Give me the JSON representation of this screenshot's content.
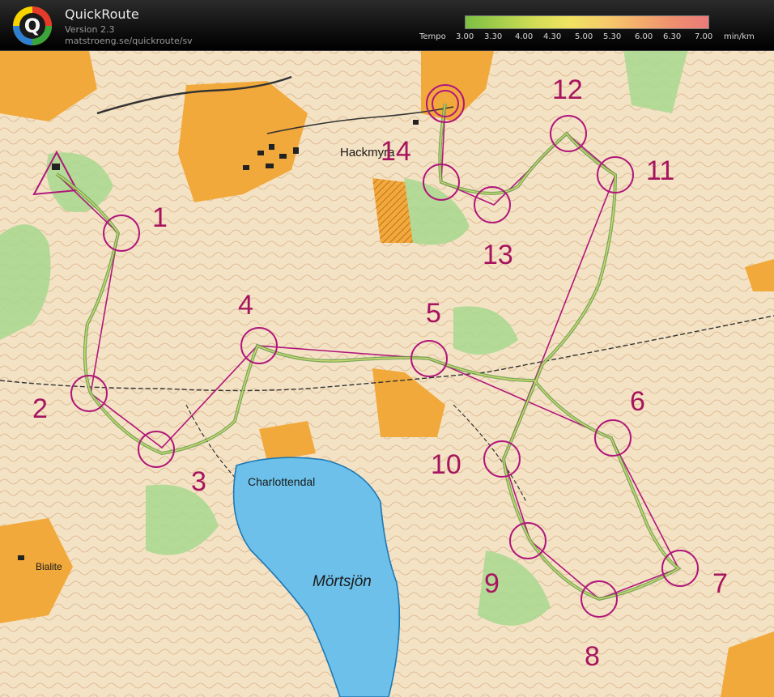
{
  "app": {
    "title": "QuickRoute",
    "version": "Version 2.3",
    "url": "matstroeng.se/quickroute/sv",
    "logo_letter": "Q"
  },
  "tempo_legend": {
    "prefix": "Tempo",
    "ticks": [
      "3.00",
      "3.30",
      "4.00",
      "4.30",
      "5.00",
      "5.30",
      "6.00",
      "6.30",
      "7.00"
    ],
    "unit": "min/km",
    "colors": [
      "#7cc043",
      "#a6cf4b",
      "#d2dd55",
      "#f1e262",
      "#f6cc6a",
      "#f4ad6c",
      "#ef8f6f",
      "#ec7a7a"
    ]
  },
  "map": {
    "place_names": [
      "Hackmyra",
      "Charlottendal",
      "Mörtsjön",
      "Bialite"
    ],
    "controls": [
      "1",
      "2",
      "3",
      "4",
      "5",
      "6",
      "7",
      "8",
      "9",
      "10",
      "11",
      "12",
      "13",
      "14"
    ],
    "colors": {
      "terrain": "#f4e2c4",
      "open_land": "#f2a93b",
      "vegetation": "#a8d88f",
      "water": "#6cc0ea",
      "contour": "#b5773e",
      "course": "#b0177a",
      "route": "#5a9a4a"
    }
  }
}
